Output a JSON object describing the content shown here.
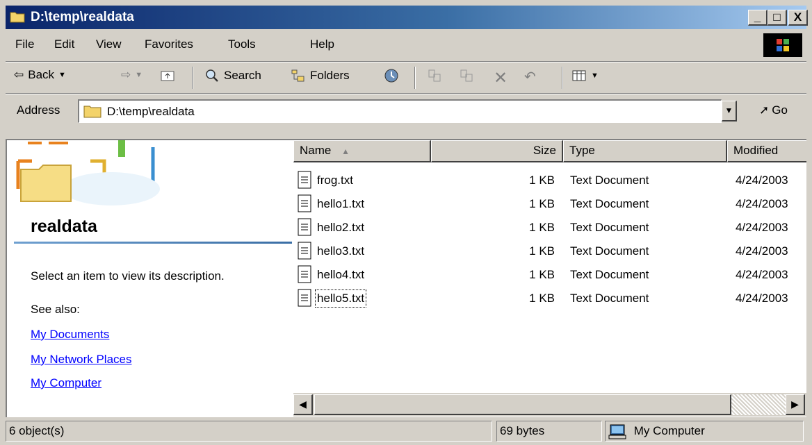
{
  "window": {
    "title": "D:\\temp\\realdata",
    "minimize": "_",
    "maximize": "□",
    "close": "X"
  },
  "menu": [
    "File",
    "Edit",
    "View",
    "Favorites",
    "Tools",
    "Help"
  ],
  "toolbar": {
    "back": "Back",
    "search": "Search",
    "folders": "Folders"
  },
  "address": {
    "label": "Address",
    "value": "D:\\temp\\realdata",
    "go": "Go"
  },
  "sidebar": {
    "folder_name": "realdata",
    "description": "Select an item to view its description.",
    "see_also": "See also:",
    "links": [
      "My Documents",
      "My Network Places",
      "My Computer"
    ]
  },
  "columns": [
    "Name",
    "Size",
    "Type",
    "Modified"
  ],
  "files": [
    {
      "name": "frog.txt",
      "size": "1 KB",
      "type": "Text Document",
      "modified": "4/24/2003"
    },
    {
      "name": "hello1.txt",
      "size": "1 KB",
      "type": "Text Document",
      "modified": "4/24/2003"
    },
    {
      "name": "hello2.txt",
      "size": "1 KB",
      "type": "Text Document",
      "modified": "4/24/2003"
    },
    {
      "name": "hello3.txt",
      "size": "1 KB",
      "type": "Text Document",
      "modified": "4/24/2003"
    },
    {
      "name": "hello4.txt",
      "size": "1 KB",
      "type": "Text Document",
      "modified": "4/24/2003"
    },
    {
      "name": "hello5.txt",
      "size": "1 KB",
      "type": "Text Document",
      "modified": "4/24/2003"
    }
  ],
  "status": {
    "objects": "6 object(s)",
    "size": "69 bytes",
    "zone": "My Computer"
  },
  "colors": {
    "titlebar_start": "#0a246a",
    "titlebar_end": "#a6caf0",
    "link": "#0000ff",
    "face": "#d4d0c8"
  }
}
